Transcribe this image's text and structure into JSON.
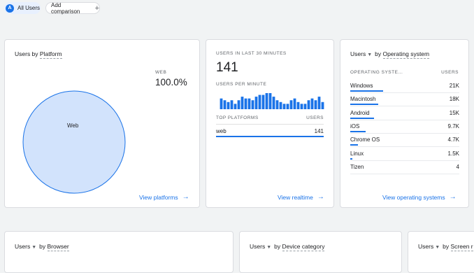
{
  "top_bar": {
    "segment_avatar": "A",
    "segment_label": "All Users",
    "add_comparison_label": "Add comparison",
    "add_icon": "plus-icon"
  },
  "platform_card": {
    "title_prefix": "Users by",
    "title_dim": "Platform",
    "legend_label": "WEB",
    "legend_value": "100.0%",
    "pie_label": "Web",
    "link_label": "View platforms",
    "pie_color": "#d2e3fc",
    "pie_stroke": "#1a73e8"
  },
  "realtime_card": {
    "header": "USERS IN LAST 30 MINUTES",
    "count": "141",
    "per_minute_label": "USERS PER MINUTE",
    "top_platforms_label": "TOP PLATFORMS",
    "users_col_label": "USERS",
    "row_platform": "web",
    "row_value": "141",
    "link_label": "View realtime",
    "bar_color": "#1a73e8"
  },
  "os_card": {
    "title_metric": "Users",
    "title_by": "by",
    "title_dim": "Operating system",
    "col_dim": "OPERATING SYSTE...",
    "col_users": "USERS",
    "rows": [
      {
        "name": "Windows",
        "value": "21K"
      },
      {
        "name": "Macintosh",
        "value": "18K"
      },
      {
        "name": "Android",
        "value": "15K"
      },
      {
        "name": "iOS",
        "value": "9.7K"
      },
      {
        "name": "Chrome OS",
        "value": "4.7K"
      },
      {
        "name": "Linux",
        "value": "1.5K"
      },
      {
        "name": "Tizen",
        "value": "4"
      }
    ],
    "link_label": "View operating systems"
  },
  "bottom_cards": [
    {
      "metric": "Users",
      "by": "by",
      "dim": "Browser"
    },
    {
      "metric": "Users",
      "by": "by",
      "dim": "Device category"
    },
    {
      "metric": "Users",
      "by": "by",
      "dim": "Screen r"
    }
  ],
  "chart_data": [
    {
      "type": "pie",
      "categories": [
        "Web"
      ],
      "values": [
        100.0
      ]
    },
    {
      "type": "bar",
      "title": "USERS PER MINUTE",
      "values": [
        6,
        5,
        4,
        5,
        3,
        5,
        7,
        6,
        6,
        5,
        7,
        8,
        8,
        9,
        9,
        7,
        5,
        4,
        3,
        3,
        5,
        6,
        4,
        3,
        3,
        5,
        6,
        5,
        7,
        4
      ]
    },
    {
      "type": "bar",
      "title": "Users by Operating system",
      "categories": [
        "Windows",
        "Macintosh",
        "Android",
        "iOS",
        "Chrome OS",
        "Linux",
        "Tizen"
      ],
      "values": [
        21000,
        18000,
        15000,
        9700,
        4700,
        1500,
        4
      ]
    }
  ]
}
